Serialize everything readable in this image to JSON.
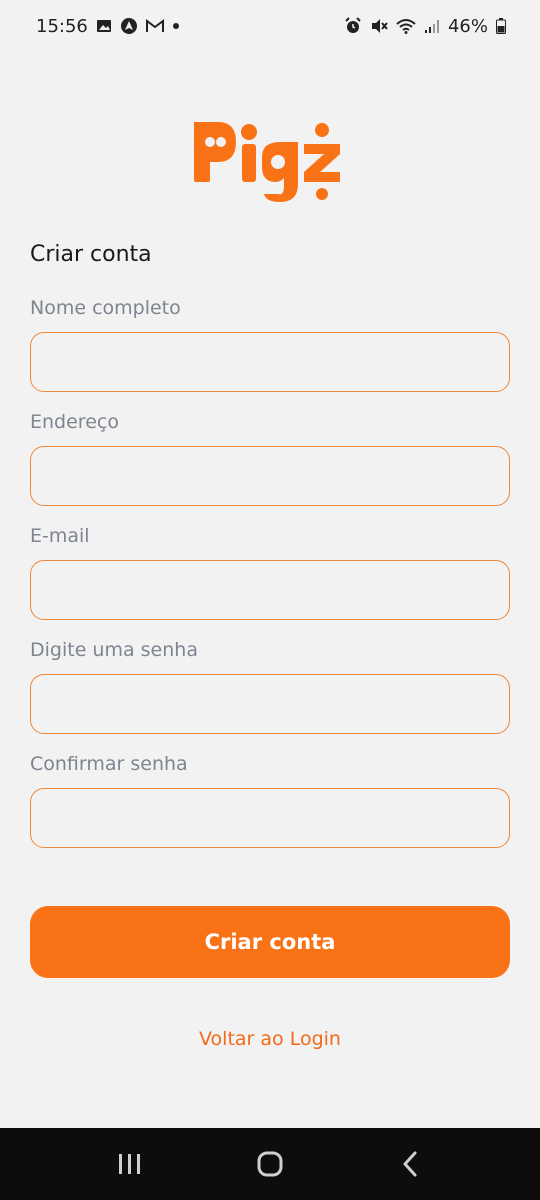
{
  "status_bar": {
    "time": "15:56",
    "battery": "46%"
  },
  "colors": {
    "accent": "#f97316",
    "field_border": "#f0883a",
    "background": "#f2f2f2"
  },
  "logo": {
    "text": "Pigz"
  },
  "form": {
    "title": "Criar conta",
    "fields": [
      {
        "label": "Nome completo",
        "value": "",
        "placeholder": ""
      },
      {
        "label": "Endereço",
        "value": "",
        "placeholder": ""
      },
      {
        "label": "E-mail",
        "value": "",
        "placeholder": ""
      },
      {
        "label": "Digite uma senha",
        "value": "",
        "placeholder": ""
      },
      {
        "label": "Confirmar senha",
        "value": "",
        "placeholder": ""
      }
    ],
    "submit_label": "Criar conta",
    "back_link": "Voltar ao Login"
  },
  "nav_bar": {
    "icons": [
      "recent-apps-icon",
      "home-icon",
      "back-icon"
    ]
  }
}
